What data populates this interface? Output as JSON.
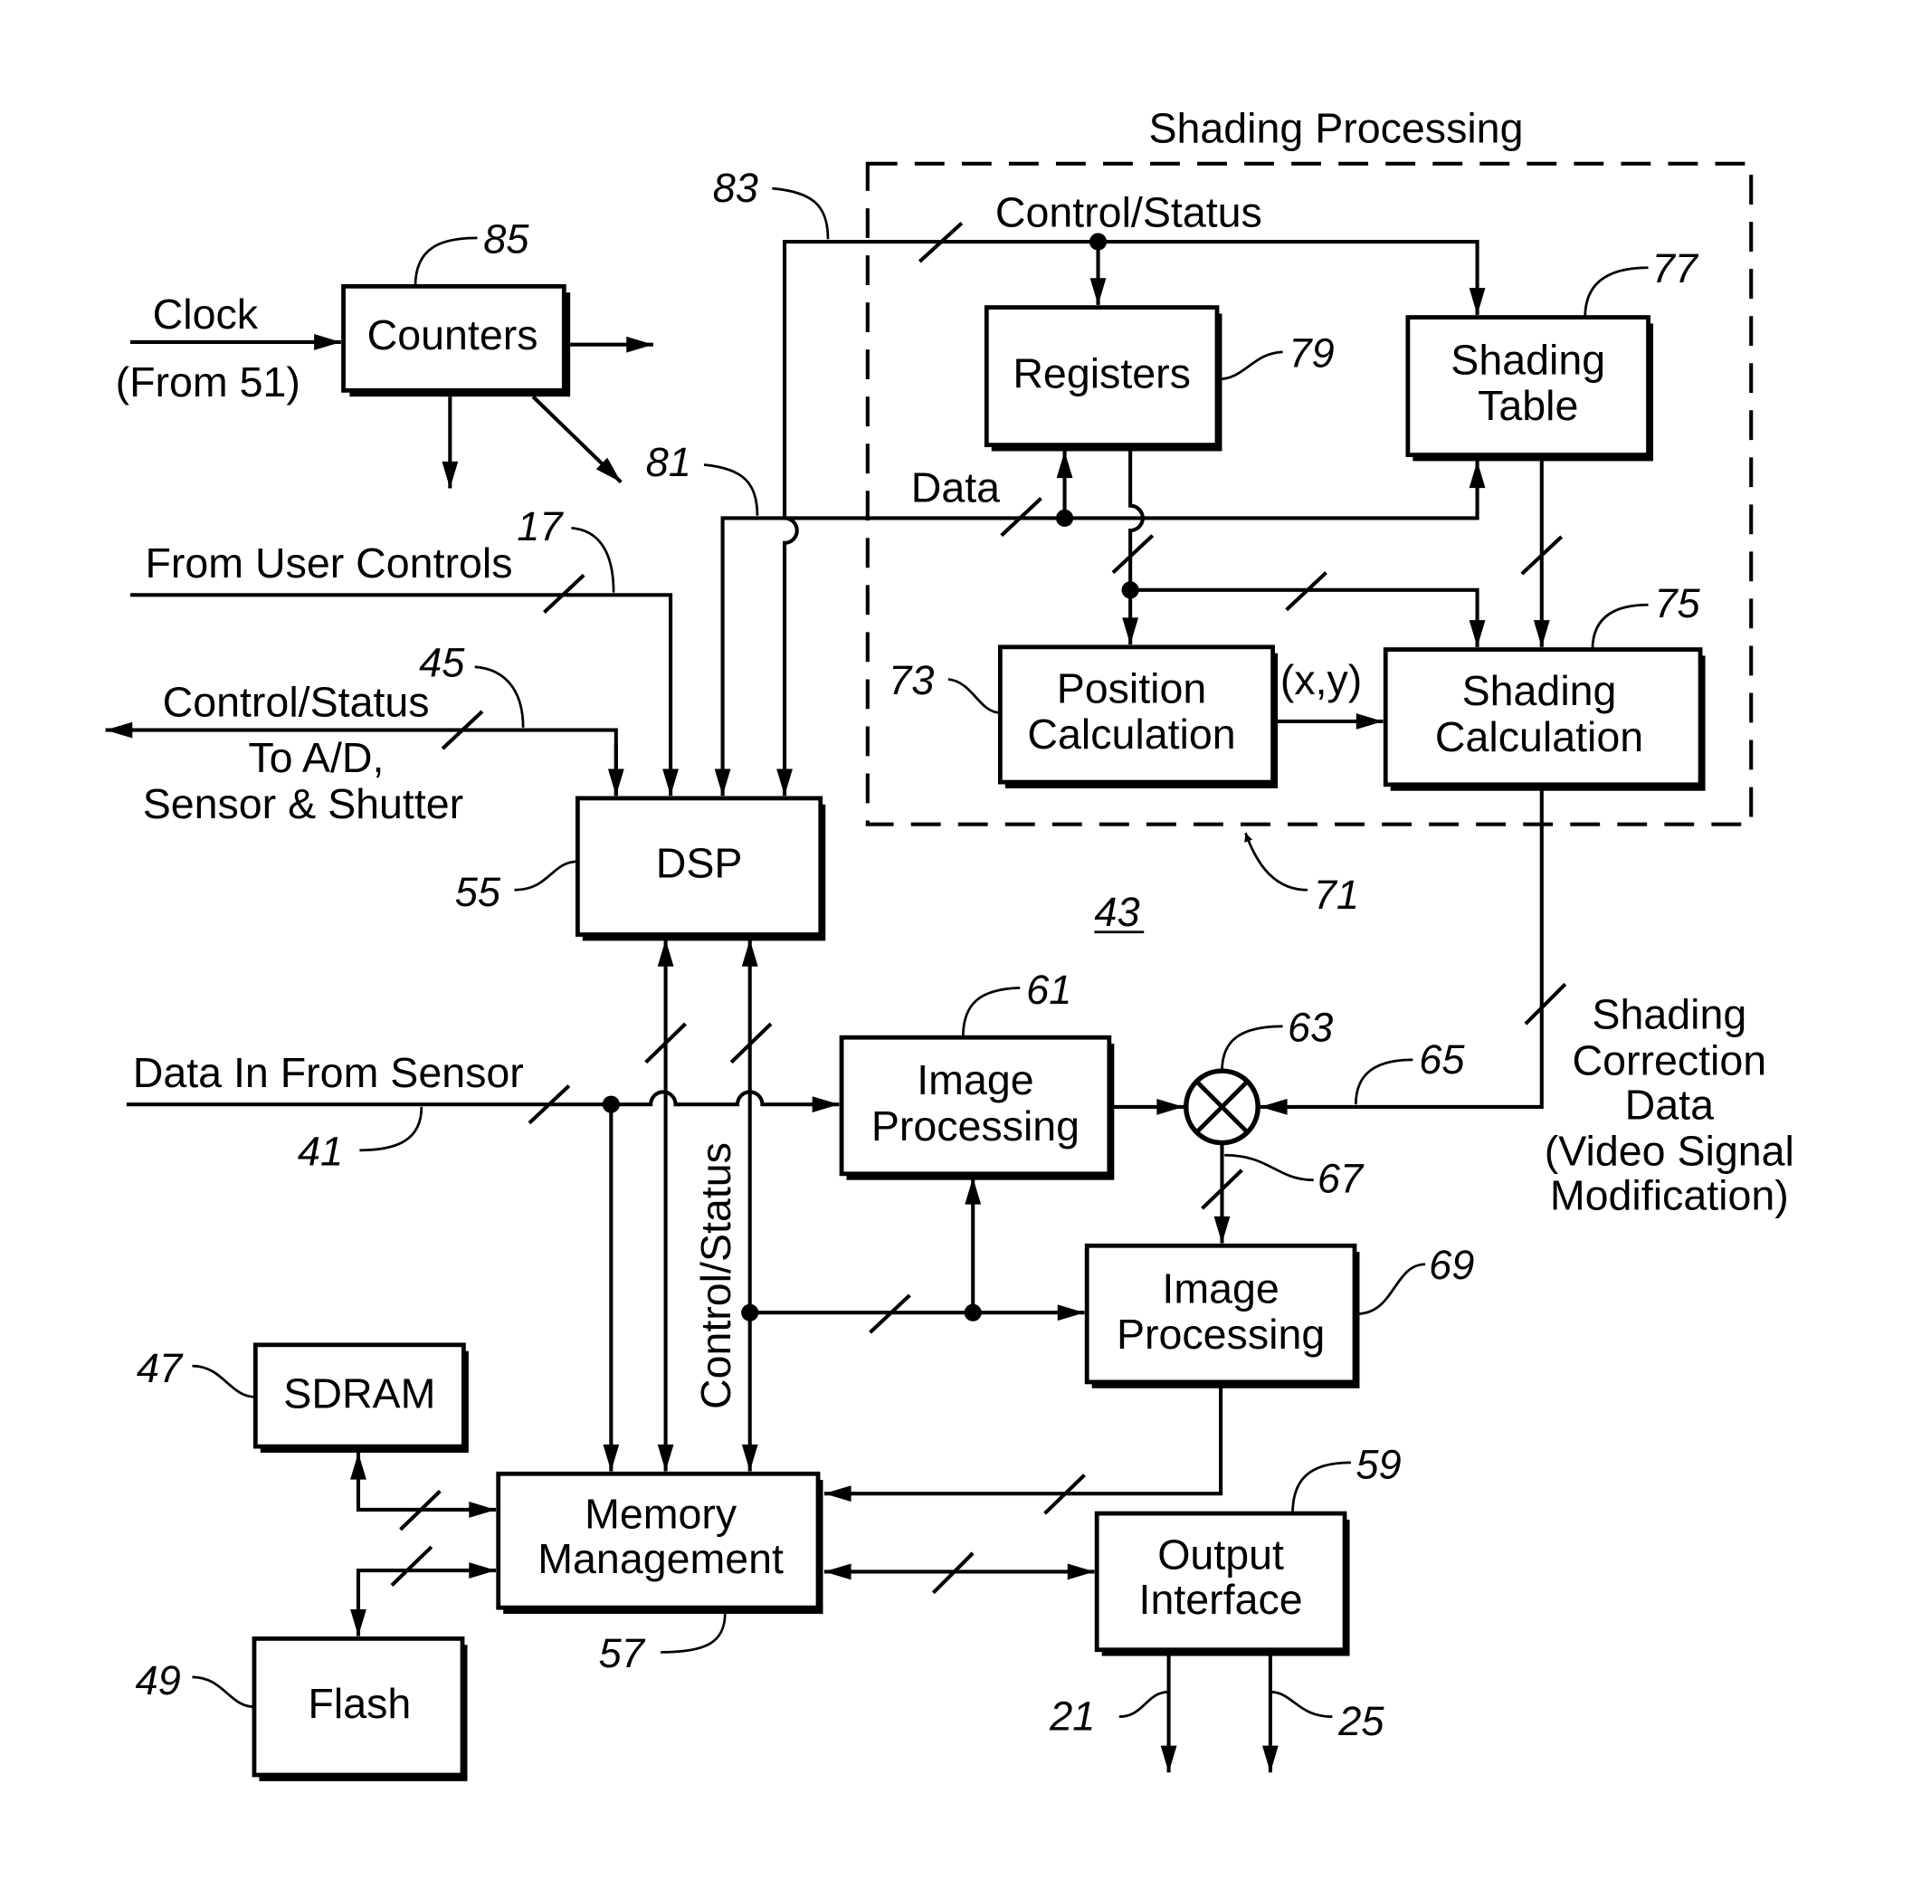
{
  "title": "Shading Processing",
  "blocks": {
    "counters": {
      "label": "Counters",
      "ref": "85"
    },
    "registers": {
      "label": "Registers",
      "ref": "79"
    },
    "shading_table": {
      "line1": "Shading",
      "line2": "Table",
      "ref": "77"
    },
    "position_calc": {
      "line1": "Position",
      "line2": "Calculation",
      "ref": "73"
    },
    "shading_calc": {
      "line1": "Shading",
      "line2": "Calculation",
      "ref": "75"
    },
    "dsp": {
      "label": "DSP",
      "ref": "55"
    },
    "image_proc_1": {
      "line1": "Image",
      "line2": "Processing",
      "ref": "61"
    },
    "image_proc_2": {
      "line1": "Image",
      "line2": "Processing",
      "ref": "69"
    },
    "multiplier": {
      "symbol": "⊗",
      "ref": "63"
    },
    "sdram": {
      "label": "SDRAM",
      "ref": "47"
    },
    "flash": {
      "label": "Flash",
      "ref": "49"
    },
    "memory": {
      "line1": "Memory",
      "line2": "Management",
      "ref": "57"
    },
    "output": {
      "line1": "Output",
      "line2": "Interface",
      "ref": "59"
    }
  },
  "labels": {
    "clock": "Clock",
    "from51": "(From 51)",
    "user_controls": "From User Controls",
    "control_status_left": "Control/Status",
    "to_ad": "To A/D,",
    "sensor_shutter": "Sensor & Shutter",
    "control_status_top": "Control/Status",
    "data": "Data",
    "xy": "(x,y)",
    "data_in": "Data In From Sensor",
    "control_status_vertical": "Control/Status",
    "shading_corr_1": "Shading",
    "shading_corr_2": "Correction",
    "shading_corr_3": "Data",
    "shading_corr_4": "(Video Signal",
    "shading_corr_5": "Modification)"
  },
  "refs": {
    "r83": "83",
    "r81": "81",
    "r17": "17",
    "r45": "45",
    "r41": "41",
    "r71": "71",
    "r43": "43",
    "r65": "65",
    "r67": "67",
    "r21": "21",
    "r25": "25"
  }
}
